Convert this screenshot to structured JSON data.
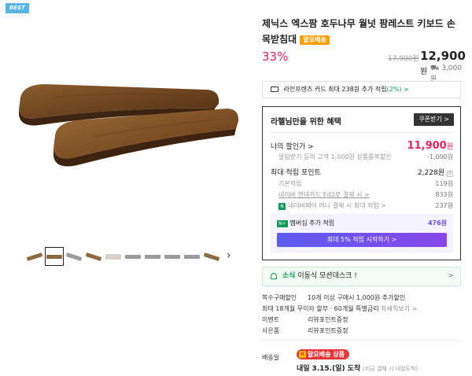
{
  "gallery": {
    "badge": "BEST",
    "next_icon": "›",
    "thumbnail_count": 10
  },
  "product": {
    "title": "제닉스 엑스팜 호두나무 월넛 팜레스트 키보드 손목받침대",
    "delivery_tag": "알요배송",
    "discount": "33%",
    "original_price": "17,900원",
    "price": "12,900",
    "price_unit": "원",
    "shipping_fee": "3,000원"
  },
  "card_promo": {
    "text": "라인프렌즈 카드 최대 238원 추가 적립",
    "highlight": "(2%) >"
  },
  "benefit": {
    "title": "라헬님만을 위한 혜택",
    "coupon_button": "쿠폰받기 >",
    "my_price_label": "나의 할인가 >",
    "my_price": "11,900",
    "my_price_unit": "원",
    "coupon_row_label": "알림받기 등의 고객 1,000원 상품중복할인",
    "coupon_row_value": "-1,000원",
    "points_label": "최대 적립 포인트",
    "points_value": "2,228원",
    "basic_label": "기본적립",
    "basic_value": "119원",
    "hyundai_label": "네이버 현대카드 Ed2로 결제 시 >",
    "hyundai_value": "833원",
    "money_label": "네이버페이 머니 결제 시 최대 적립 >",
    "money_value": "237원",
    "member_label": "멤버십 추가 적립",
    "member_value": "476원",
    "member_cta": "최대 5% 적립 시작하기 >"
  },
  "sale_notice": {
    "highlight": "소식",
    "text": "이동식 모션데스크 !",
    "chevron": ">"
  },
  "options": [
    {
      "key": "복수구매할인",
      "value": "10개 이상 구매시 1,000원 추가할인",
      "extra": ""
    },
    {
      "key": "최대 18개월 무이자 할부 · 60개월 특별금리",
      "value": "",
      "extra": "자세히보기 >"
    },
    {
      "key": "이벤트",
      "value": "리뷰포인트증정",
      "extra": ""
    },
    {
      "key": "사은품",
      "value": "리뷰포인트증정",
      "extra": ""
    }
  ],
  "shipping": {
    "label": "배송일",
    "tag": "알요배송 상품",
    "arrival_prefix": "내일",
    "arrival_date": "3.15.(일) 도착",
    "arrival_note": "(지금 결제 시 내일도착)"
  },
  "colors": {
    "accent_red": "#e1245c",
    "accent_green": "#0a9a55",
    "accent_purple": "#6d4fe0"
  }
}
